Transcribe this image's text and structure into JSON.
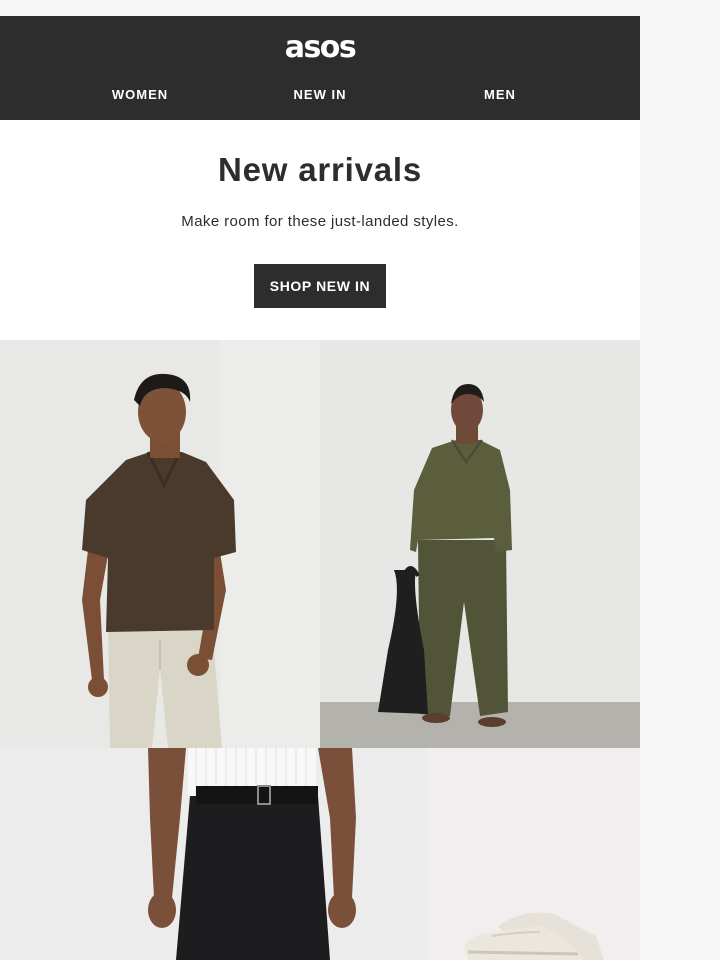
{
  "header": {
    "logo": "asos",
    "nav": [
      {
        "label": "WOMEN"
      },
      {
        "label": "NEW IN"
      },
      {
        "label": "MEN"
      }
    ]
  },
  "hero": {
    "title": "New arrivals",
    "subtitle": "Make room for these just-landed styles.",
    "cta_label": "SHOP NEW IN"
  },
  "colors": {
    "page_background": "#f7f7f7",
    "header_background": "#2d2d2d",
    "button_background": "#2d2d2d",
    "text_dark": "#2d2d2d",
    "text_light": "#ffffff"
  }
}
